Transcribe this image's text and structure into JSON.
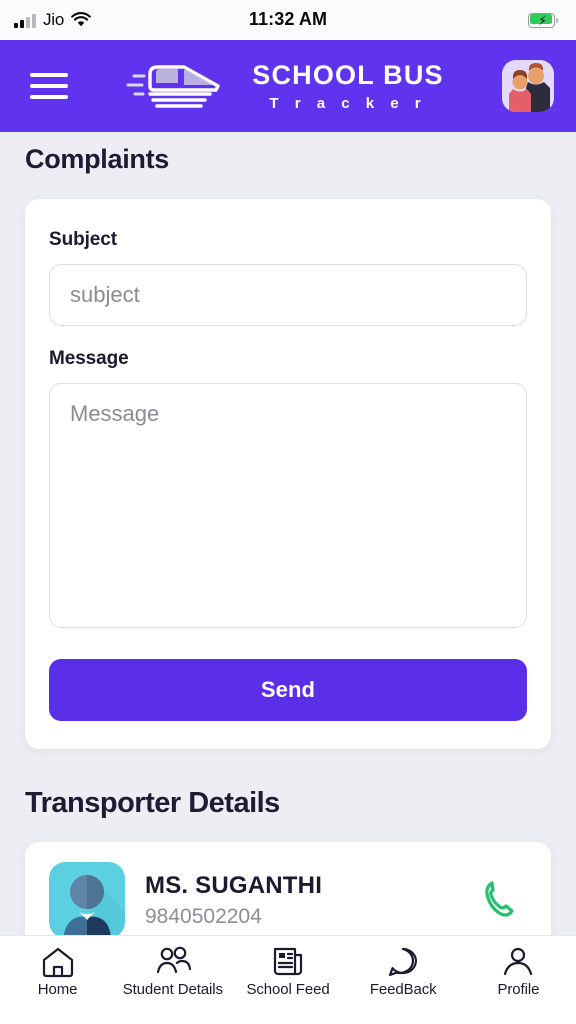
{
  "status_bar": {
    "carrier": "Jio",
    "time": "11:32 AM",
    "signal_icon": "cellular-signal-icon",
    "wifi_icon": "wifi-icon",
    "battery_icon": "battery-charging-icon"
  },
  "header": {
    "menu_icon": "hamburger-menu-icon",
    "logo_icon": "school-bus-logo-icon",
    "brand_main": "SCHOOL BUS",
    "brand_sub": "T r a c k e r",
    "avatar_icon": "user-avatar-icon",
    "background_color": "#6034ef"
  },
  "main": {
    "page_title": "Complaints",
    "form": {
      "subject_label": "Subject",
      "subject_value": "",
      "subject_placeholder": "subject",
      "message_label": "Message",
      "message_value": "",
      "message_placeholder": "Message",
      "send_label": "Send",
      "send_color": "#5b2eea"
    },
    "transporter": {
      "section_title": "Transporter Details",
      "contacts": [
        {
          "name": "MS. SUGANTHI",
          "phone": "9840502204",
          "avatar_icon": "contact-avatar-icon",
          "call_icon": "phone-call-icon",
          "call_color": "#23c16b"
        }
      ]
    }
  },
  "bottom_nav": {
    "items": [
      {
        "label": "Home",
        "icon": "home-icon"
      },
      {
        "label": "Student Details",
        "icon": "students-icon"
      },
      {
        "label": "School Feed",
        "icon": "newspaper-icon"
      },
      {
        "label": "FeedBack",
        "icon": "chat-bubble-icon"
      },
      {
        "label": "Profile",
        "icon": "person-icon"
      }
    ]
  }
}
